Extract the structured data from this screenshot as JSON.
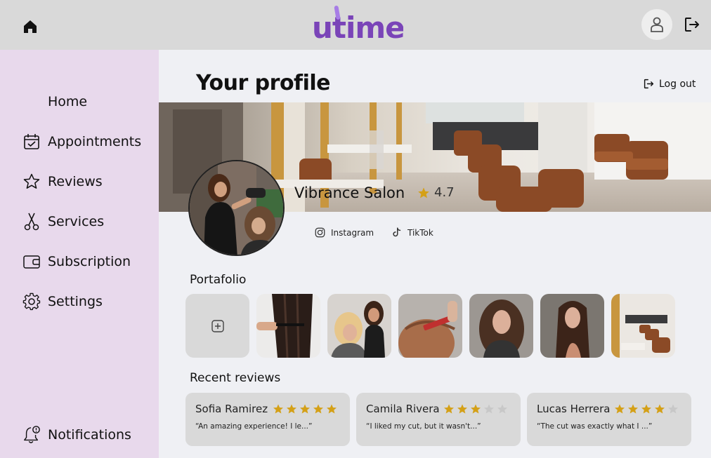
{
  "header": {
    "logo_text": "utime",
    "brand_color": "#7a44b8"
  },
  "sidebar": {
    "items": [
      {
        "label": "Home",
        "icon": "home-icon"
      },
      {
        "label": "Appointments",
        "icon": "calendar-icon"
      },
      {
        "label": "Reviews",
        "icon": "star-icon"
      },
      {
        "label": "Services",
        "icon": "scissors-icon"
      },
      {
        "label": "Subscription",
        "icon": "wallet-icon"
      },
      {
        "label": "Settings",
        "icon": "gear-icon"
      }
    ],
    "notifications_label": "Notifications"
  },
  "main": {
    "title": "Your profile",
    "logout_label": "Log out",
    "salon_name": "Vibrance Salon",
    "rating": "4.7",
    "social": [
      {
        "label": "Instagram",
        "icon": "instagram-icon"
      },
      {
        "label": "TikTok",
        "icon": "tiktok-icon"
      }
    ],
    "portfolio_title": "Portafolio",
    "reviews_title": "Recent reviews",
    "reviews": [
      {
        "name": "Sofia Ramirez",
        "stars": 5,
        "text": "“An amazing experience! I le...”"
      },
      {
        "name": "Camila Rivera",
        "stars": 3,
        "text": "“I liked my cut, but it wasn't...”"
      },
      {
        "name": "Lucas Herrera",
        "stars": 4,
        "text": "“The cut was exactly what I ...”"
      }
    ]
  },
  "colors": {
    "sidebar_bg": "#e8d9ec",
    "topbar_bg": "#d9d9d9",
    "star_filled": "#d4a017",
    "star_empty": "#c8c8c8"
  }
}
